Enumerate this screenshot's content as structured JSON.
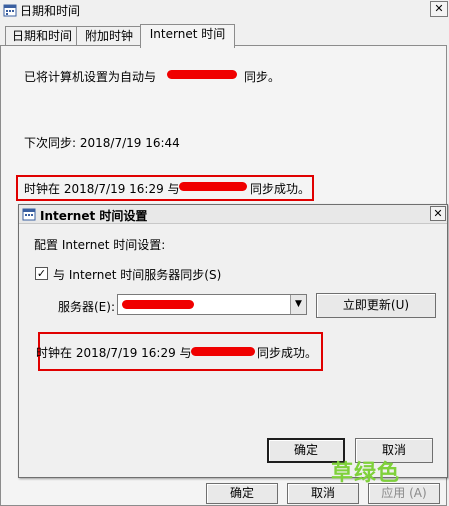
{
  "outer": {
    "title": "日期和时间",
    "close_glyph": "✕",
    "tabs": [
      "日期和时间",
      "附加时钟",
      "Internet 时间"
    ],
    "auto_sync_prefix": "已将计算机设置为自动与",
    "auto_sync_suffix": "同步。",
    "next_sync": "下次同步: 2018/7/19 16:44",
    "success_prefix": "时钟在 2018/7/19 16:29 与",
    "success_suffix": "同步成功。",
    "buttons": {
      "ok": "确定",
      "cancel": "取消",
      "apply": "应用 (A)"
    }
  },
  "dialog": {
    "title": "Internet 时间设置",
    "close_glyph": "✕",
    "configure_label": "配置 Internet 时间设置:",
    "sync_checkbox_label": "与 Internet 时间服务器同步(S)",
    "sync_checked": true,
    "check_glyph": "✓",
    "server_label": "服务器(E):",
    "update_now_button": "立即更新(U)",
    "success_prefix": "时钟在 2018/7/19 16:29 与",
    "success_suffix": "同步成功。",
    "ok_button": "确定",
    "cancel_button": "取消",
    "dropdown_glyph": "▼"
  },
  "watermark": "草绿色",
  "colors": {
    "annotation_red": "#e00000",
    "watermark_green": "#7fd13b"
  }
}
